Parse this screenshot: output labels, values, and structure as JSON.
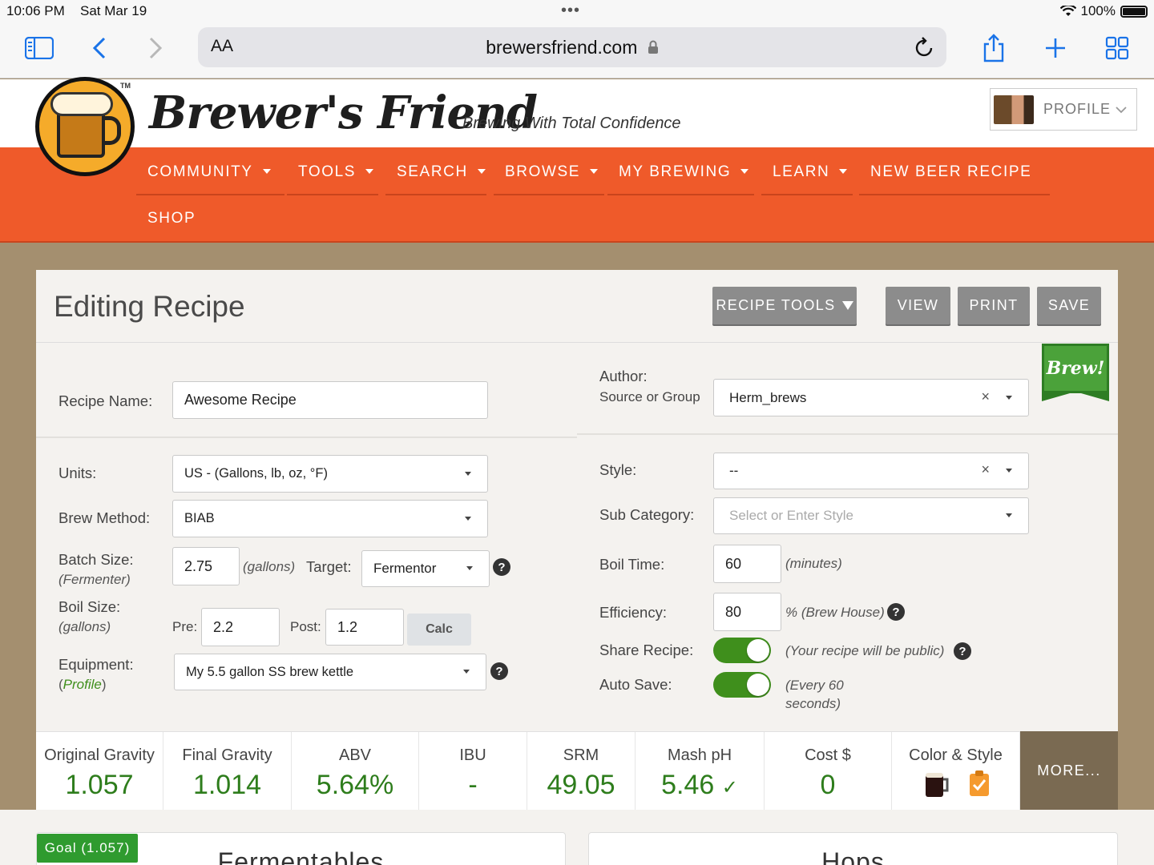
{
  "status": {
    "time": "10:06 PM",
    "date": "Sat Mar 19",
    "battery": "100%"
  },
  "browser": {
    "aa": "AA",
    "url": "brewersfriend.com"
  },
  "site": {
    "brand": "Brewer's Friend",
    "tagline": "Brewing With Total Confidence",
    "tm": "TM",
    "profile": "PROFILE"
  },
  "nav": {
    "items": [
      {
        "label": "COMMUNITY"
      },
      {
        "label": "TOOLS"
      },
      {
        "label": "SEARCH"
      },
      {
        "label": "BROWSE"
      },
      {
        "label": "MY BREWING"
      },
      {
        "label": "LEARN"
      },
      {
        "label": "NEW BEER RECIPE"
      }
    ],
    "shop": "SHOP"
  },
  "panel": {
    "title": "Editing Recipe",
    "recipe_tools": "RECIPE TOOLS",
    "view": "VIEW",
    "print": "PRINT",
    "save": "SAVE",
    "brew_badge": "Brew!"
  },
  "form": {
    "recipe_name_label": "Recipe Name:",
    "recipe_name": "Awesome Recipe",
    "author_label": "Author:",
    "source_label": "Source or Group",
    "author": "Herm_brews",
    "units_label": "Units:",
    "units": "US - (Gallons, lb, oz, °F)",
    "brew_method_label": "Brew Method:",
    "brew_method": "BIAB",
    "batch_label": "Batch Size:",
    "batch_sub": "(Fermenter)",
    "batch_size": "2.75",
    "batch_unit": "(gallons)",
    "target_label": "Target:",
    "target": "Fermentor",
    "boil_label": "Boil Size:",
    "boil_sub": "(gallons)",
    "pre_label": "Pre:",
    "pre": "2.2",
    "post_label": "Post:",
    "post": "1.2",
    "calc": "Calc",
    "equipment_label": "Equipment:",
    "equipment_open": "(",
    "equipment_link": "Profile",
    "equipment_close": ")",
    "equipment": "My 5.5 gallon SS brew kettle",
    "style_label": "Style:",
    "style": "--",
    "subcat_label": "Sub Category:",
    "subcat_placeholder": "Select or Enter Style",
    "boil_time_label": "Boil Time:",
    "boil_time": "60",
    "boil_time_unit": "(minutes)",
    "efficiency_label": "Efficiency:",
    "efficiency": "80",
    "efficiency_unit": "% (Brew House)",
    "share_label": "Share Recipe:",
    "share_note": "(Your recipe will be public)",
    "share_on": true,
    "autosave_label": "Auto Save:",
    "autosave_note1": "(Every 60",
    "autosave_note2": "seconds)",
    "autosave_on": true,
    "clear": "×",
    "help": "?"
  },
  "stats": [
    {
      "title": "Original Gravity",
      "value": "1.057"
    },
    {
      "title": "Final Gravity",
      "value": "1.014"
    },
    {
      "title": "ABV",
      "value": "5.64%"
    },
    {
      "title": "IBU",
      "value": "-"
    },
    {
      "title": "SRM",
      "value": "49.05"
    },
    {
      "title": "Mash pH",
      "value": "5.46",
      "mark": "✓"
    },
    {
      "title": "Cost $",
      "value": "0"
    },
    {
      "title": "Color & Style",
      "value": ""
    }
  ],
  "more": "MORE...",
  "goal": "Goal (1.057)",
  "cards": {
    "fermentables": "Fermentables",
    "hops": "Hops"
  },
  "colors": {
    "accent": "#ef5a2a",
    "green": "#2e7d1c",
    "button_gray": "#8c8c8c"
  }
}
